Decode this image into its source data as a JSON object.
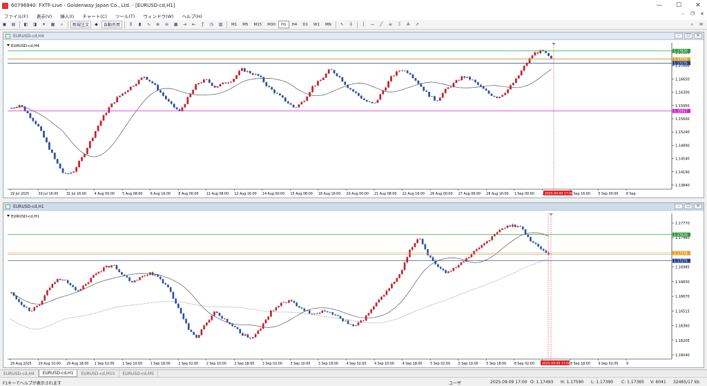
{
  "app": {
    "title": "60796940: FXTF-Live - Goldenway Japan Co., Ltd. - [EURUSD-cd,H1]"
  },
  "menu": {
    "items": [
      "ファイル(F)",
      "表示(V)",
      "挿入(I)",
      "チャート(C)",
      "ツール(T)",
      "ウィンドウ(W)",
      "ヘルプ(H)"
    ]
  },
  "toolbar": {
    "new_order_label": "新規注文",
    "auto_trade_label": "自動売買",
    "timeframes": [
      "M1",
      "M5",
      "M15",
      "M30",
      "H1",
      "H4",
      "D1",
      "W1",
      "MN"
    ],
    "active_timeframe": "H1"
  },
  "colors": {
    "bull": "#c0202a",
    "bear": "#2a4ea0",
    "ma": "#555555",
    "green_line": "#2a9a3a",
    "orange_line": "#e8a020",
    "blue_line": "#1c3f94",
    "magenta_line": "#d020d0",
    "red_marker": "#e02020"
  },
  "charts": [
    {
      "window_title": "EURUSD-cd,H4",
      "symbol_label": "EURUSD-cd,H4",
      "price_labels": [
        "1.17620",
        "1.17376",
        "1.17275",
        "1.15917"
      ],
      "price_ticks": [
        "1.17360",
        "1.17000",
        "1.16650",
        "1.16300",
        "1.15950",
        "1.15600",
        "1.15240",
        "1.14890",
        "1.14540",
        "1.14190",
        "1.13840"
      ],
      "time_labels": [
        "29 Jul 2025",
        "30 Jul 16:00",
        "31 Jul 16:00",
        "4 Aug 00:00",
        "5 Aug 08:00",
        "6 Aug 16:00",
        "8 Aug 00:00",
        "11 Aug 08:00",
        "12 Aug 16:00",
        "14 Aug 00:00",
        "15 Aug 08:00",
        "18 Aug 16:00",
        "20 Aug 00:00",
        "21 Aug 08:00",
        "22 Aug 16:00",
        "26 Aug 00:00",
        "27 Aug 08:00",
        "28 Aug 16:00",
        "1 Sep 00:00",
        "2 Sep 08:00",
        "3 Sep 16:00",
        "5 Sep 00:00",
        "8 Sep"
      ],
      "time_marker": "2025.09.09 17:00"
    },
    {
      "window_title": "EURUSD-cd,H1",
      "symbol_label": "EURUSD-cd,H1",
      "price_labels": [
        "1.17620",
        "1.17376",
        "1.17275"
      ],
      "price_ticks": [
        "1.17770",
        "1.17460",
        "1.17145",
        "1.16985",
        "1.16830",
        "1.16670",
        "1.16515",
        "1.16360",
        "1.16205",
        "1.16040"
      ],
      "time_labels": [
        "29 Aug 2025",
        "29 Aug 10:00",
        "29 Aug 18:00",
        "1 Sep 02:00",
        "1 Sep 10:00",
        "1 Sep 18:00",
        "2 Sep 02:00",
        "2 Sep 10:00",
        "2 Sep 18:00",
        "3 Sep 02:00",
        "3 Sep 10:00",
        "3 Sep 18:00",
        "4 Sep 02:00",
        "4 Sep 10:00",
        "4 Sep 18:00",
        "5 Sep 02:00",
        "5 Sep 10:00",
        "5 Sep 18:00",
        "8 Sep 02:00",
        "8 Sep 10:00",
        "8 Sep 18:00",
        "9 Sep 02:00",
        "9"
      ],
      "time_marker": "2025.09.09 17:00"
    }
  ],
  "tabs": [
    "EURUSD-cd,H4",
    "EURUSD-cd,H1",
    "EURUSD-cd,M15",
    "EURUSD-cd,M5"
  ],
  "active_tab": "EURUSD-cd,H1",
  "status": {
    "help": "F1キーでヘルプが表示されます",
    "profile": "ユーザ",
    "time": "2025.09.09 17:00",
    "open": "O: 1.17493",
    "high": "H: 1.17590",
    "low": "L: 1.17390",
    "close": "C: 1.17365",
    "volume": "V: 6041",
    "traffic": "32465/17 kb"
  },
  "chart_data": [
    {
      "type": "candlestick",
      "title": "EURUSD-cd,H4",
      "ylim": [
        1.137,
        1.1785
      ],
      "trend": [
        1.16,
        1.161,
        1.158,
        1.155,
        1.15,
        1.145,
        1.141,
        1.142,
        1.146,
        1.151,
        1.156,
        1.16,
        1.163,
        1.165,
        1.167,
        1.169,
        1.167,
        1.164,
        1.161,
        1.159,
        1.163,
        1.167,
        1.168,
        1.166,
        1.167,
        1.168,
        1.171,
        1.17,
        1.169,
        1.166,
        1.164,
        1.162,
        1.16,
        1.162,
        1.166,
        1.168,
        1.171,
        1.169,
        1.166,
        1.164,
        1.162,
        1.161,
        1.165,
        1.169,
        1.171,
        1.17,
        1.167,
        1.164,
        1.162,
        1.165,
        1.167,
        1.169,
        1.168,
        1.166,
        1.164,
        1.163,
        1.165,
        1.168,
        1.172,
        1.1755,
        1.1762,
        1.1738
      ],
      "ma_start": 1.162,
      "ma_end": 1.1708
    },
    {
      "type": "candlestick",
      "title": "EURUSD-cd,H1",
      "ylim": [
        1.1598,
        1.179
      ],
      "trend": [
        1.1685,
        1.1672,
        1.1662,
        1.1668,
        1.169,
        1.1705,
        1.17,
        1.1688,
        1.1695,
        1.171,
        1.1718,
        1.1722,
        1.171,
        1.17,
        1.1706,
        1.1712,
        1.1705,
        1.169,
        1.1665,
        1.164,
        1.1625,
        1.1645,
        1.166,
        1.165,
        1.164,
        1.163,
        1.1625,
        1.164,
        1.166,
        1.167,
        1.1675,
        1.1668,
        1.166,
        1.1658,
        1.1662,
        1.1655,
        1.1648,
        1.164,
        1.165,
        1.1665,
        1.168,
        1.1695,
        1.171,
        1.174,
        1.176,
        1.1735,
        1.1718,
        1.1712,
        1.172,
        1.173,
        1.174,
        1.175,
        1.176,
        1.177,
        1.1775,
        1.1772,
        1.1755,
        1.1745,
        1.1737
      ],
      "ma_start": 1.1672,
      "ma_end": 1.172
    }
  ]
}
